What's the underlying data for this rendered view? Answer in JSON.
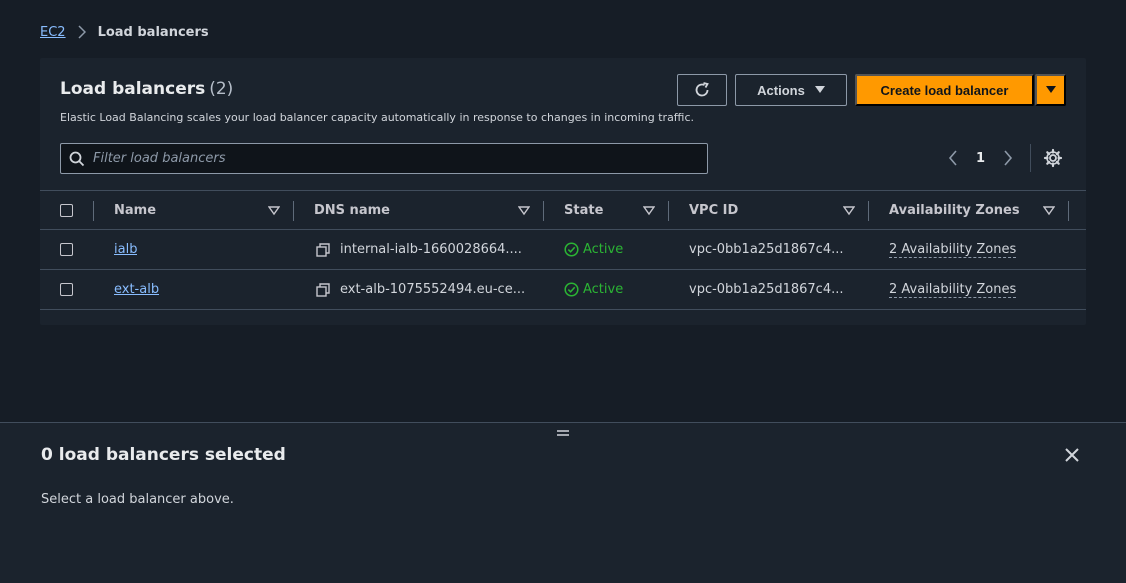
{
  "breadcrumb": {
    "root": "EC2",
    "current": "Load balancers"
  },
  "panel": {
    "title": "Load balancers",
    "count": "(2)",
    "description": "Elastic Load Balancing scales your load balancer capacity automatically in response to changes in incoming traffic."
  },
  "toolbar": {
    "refresh_icon": "refresh-icon",
    "actions_label": "Actions",
    "create_label": "Create load balancer"
  },
  "search": {
    "placeholder": "Filter load balancers"
  },
  "pagination": {
    "current_page": "1"
  },
  "table": {
    "columns": [
      "Name",
      "DNS name",
      "State",
      "VPC ID",
      "Availability Zones"
    ],
    "rows": [
      {
        "name": "ialb",
        "dns": "internal-ialb-1660028664....",
        "state": "Active",
        "vpc": "vpc-0bb1a25d1867c4...",
        "az": "2 Availability Zones"
      },
      {
        "name": "ext-alb",
        "dns": "ext-alb-1075552494.eu-ce...",
        "state": "Active",
        "vpc": "vpc-0bb1a25d1867c4...",
        "az": "2 Availability Zones"
      }
    ]
  },
  "split_panel": {
    "title": "0 load balancers selected",
    "body": "Select a load balancer above."
  },
  "colors": {
    "accent": "#ff9900",
    "link": "#89bdff",
    "success": "#2bb534",
    "background": "#161d26",
    "surface": "#1b232d"
  }
}
